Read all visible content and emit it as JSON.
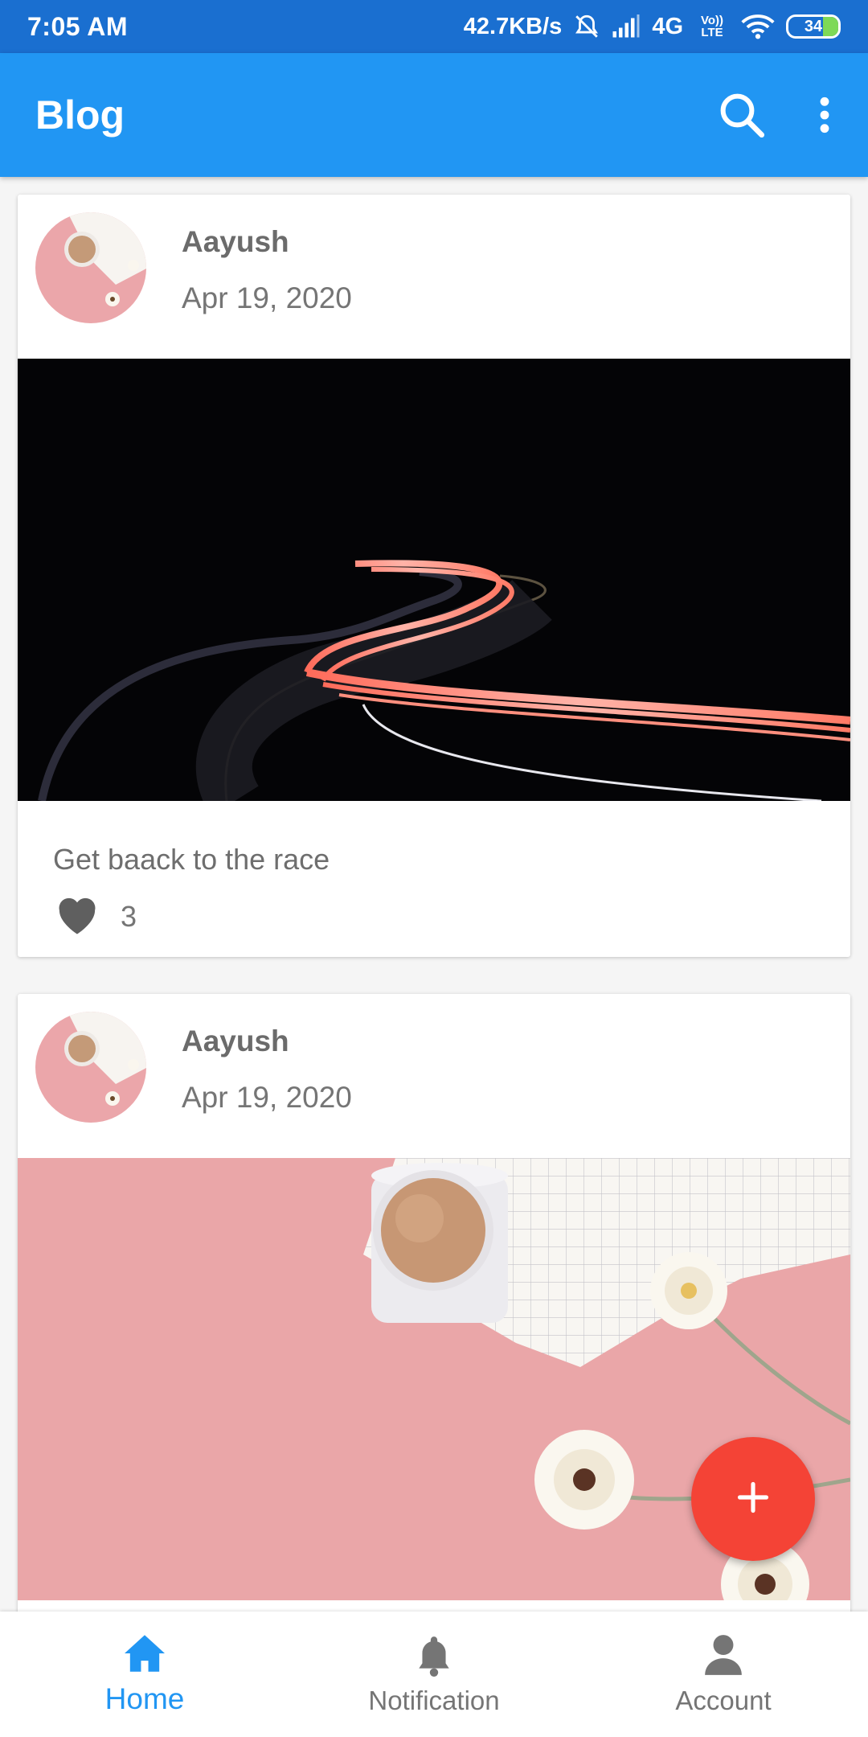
{
  "status_bar": {
    "time": "7:05 AM",
    "net_speed": "42.7KB/s",
    "network": "4G",
    "volte": "Vo)) LTE",
    "battery": "34"
  },
  "app_bar": {
    "title": "Blog",
    "search_icon": "search-icon",
    "more_icon": "more-vert-icon"
  },
  "posts": [
    {
      "author": "Aayush",
      "date": "Apr 19, 2020",
      "title": "Get baack to the race",
      "likes": "3",
      "image": "light-trail-road-photo"
    },
    {
      "author": "Aayush",
      "date": "Apr 19, 2020",
      "image": "coffee-flowers-photo"
    }
  ],
  "fab": {
    "icon": "add-icon",
    "color": "#f44336"
  },
  "bottom_nav": [
    {
      "label": "Home",
      "icon": "home-icon",
      "active": true
    },
    {
      "label": "Notification",
      "icon": "bell-icon",
      "active": false
    },
    {
      "label": "Account",
      "icon": "person-icon",
      "active": false
    }
  ],
  "colors": {
    "primary": "#2196f3",
    "status_bar": "#1a6fd0",
    "accent": "#f44336"
  }
}
